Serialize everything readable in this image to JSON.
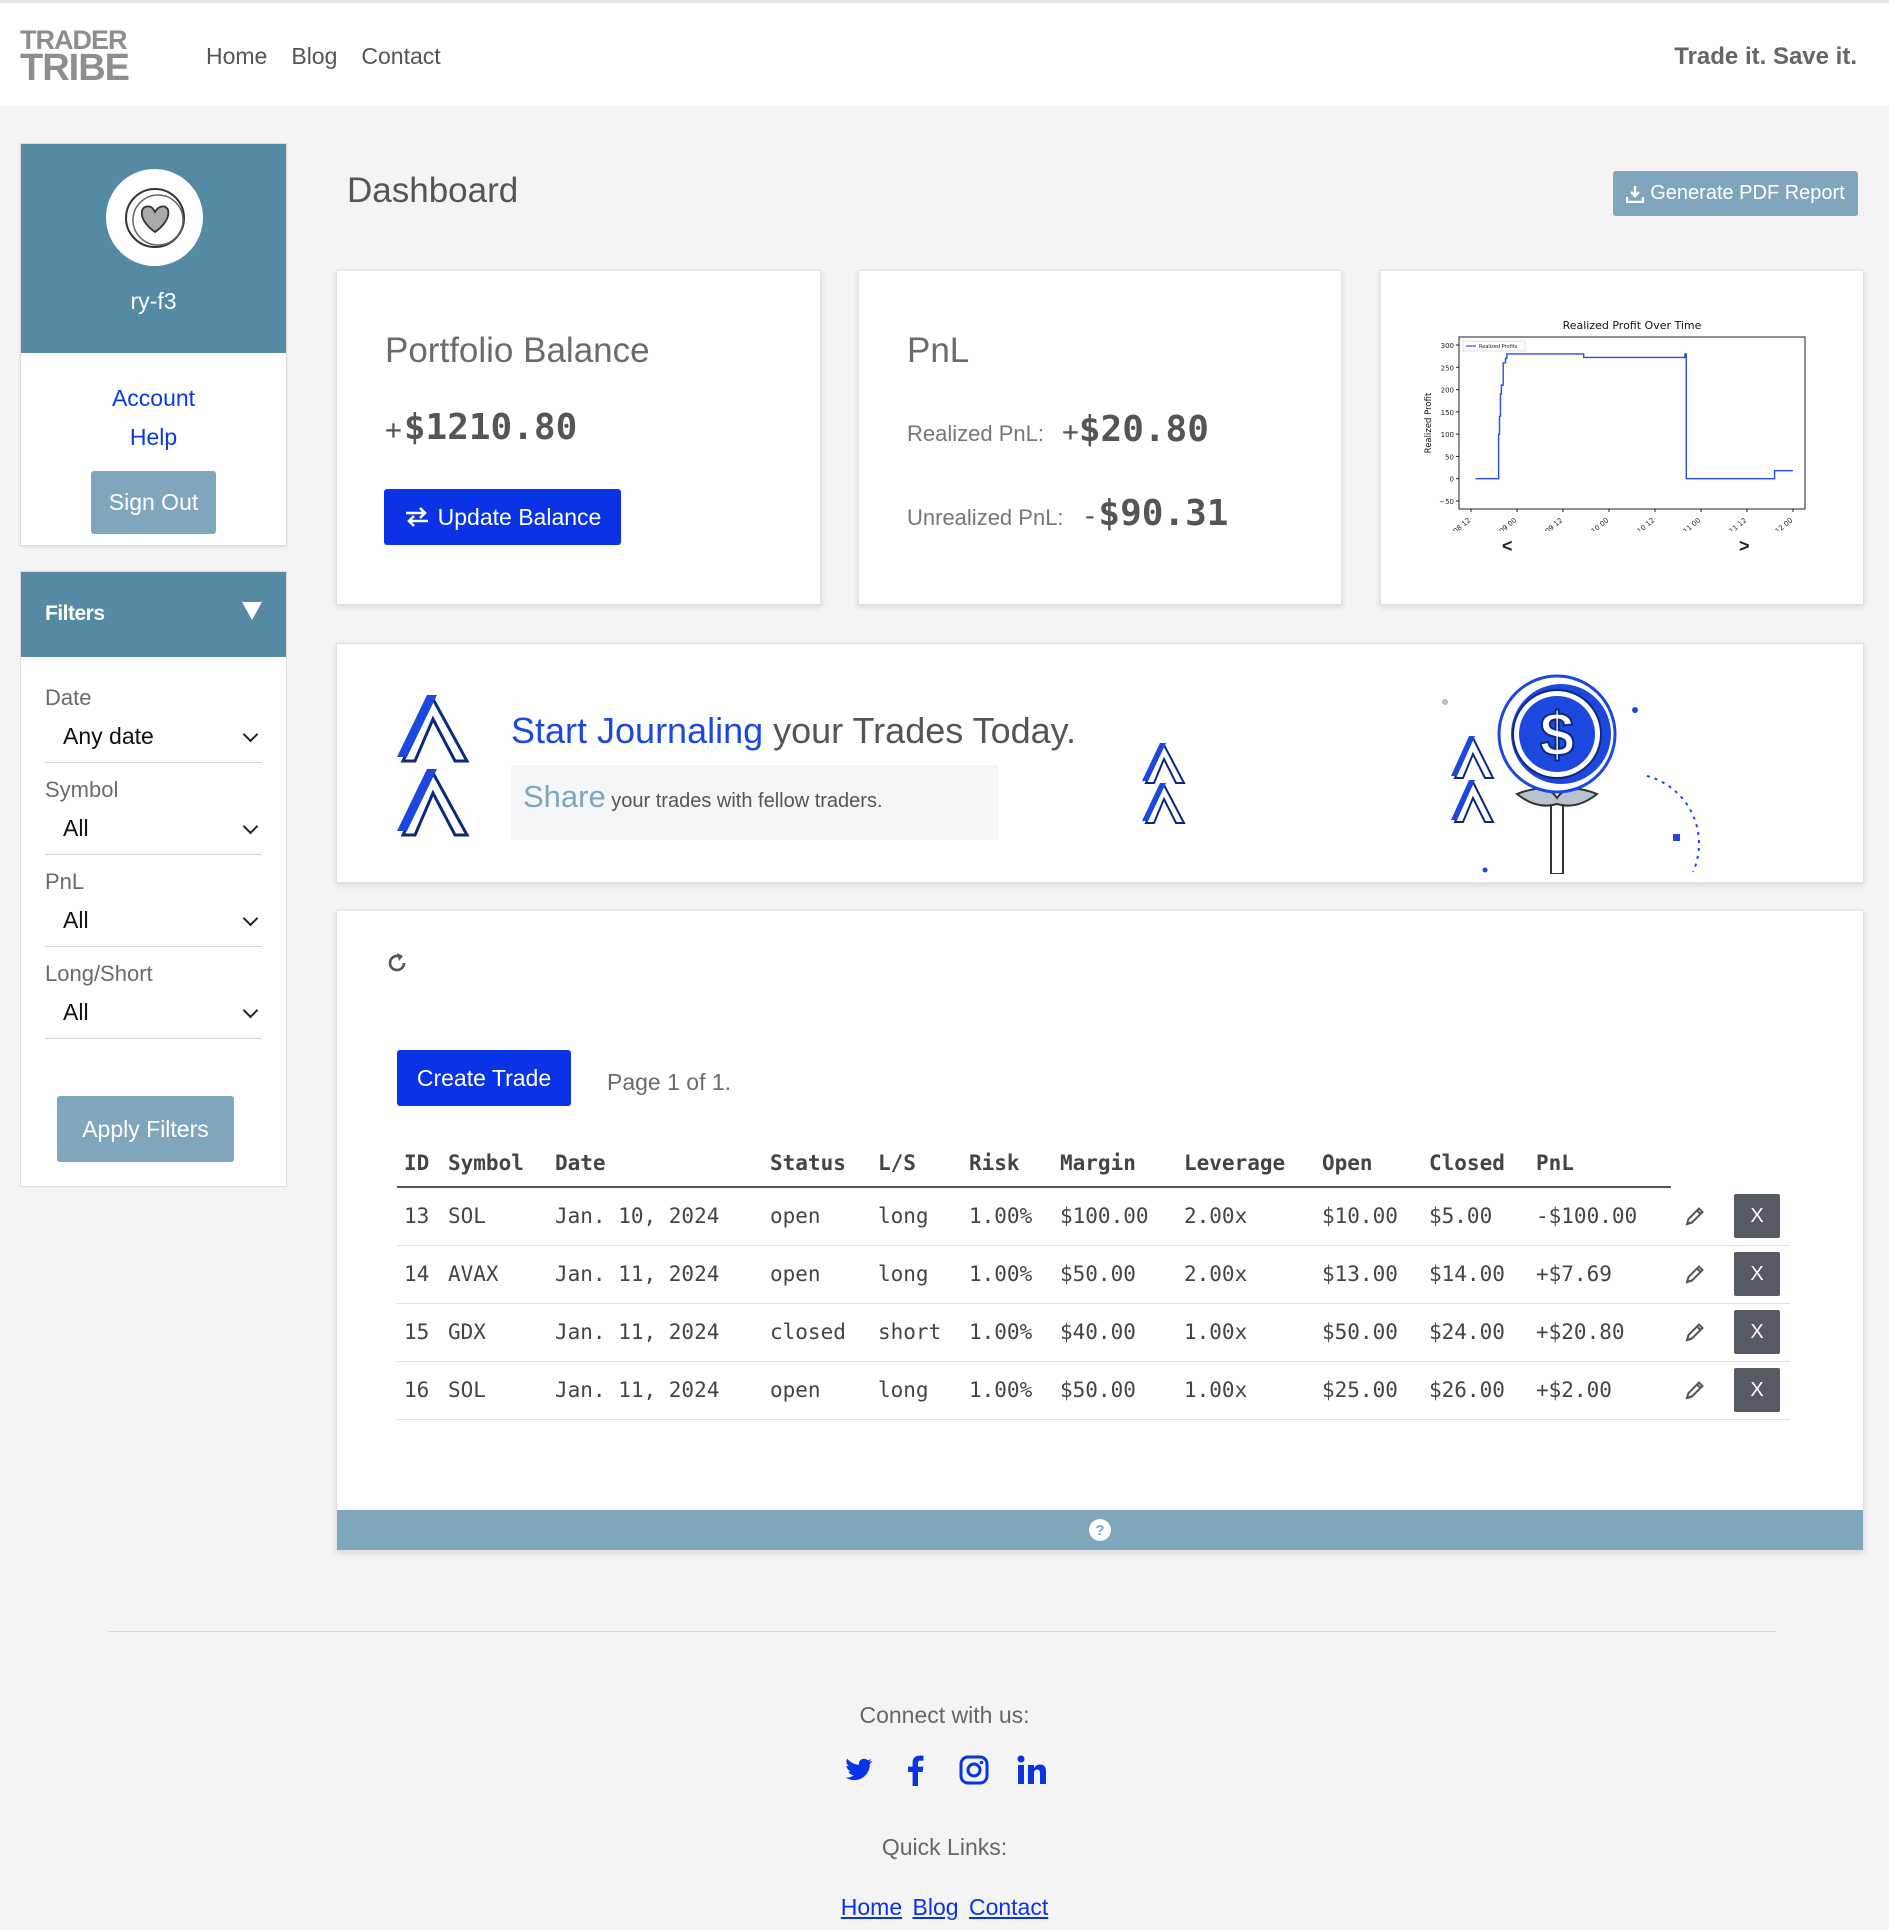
{
  "brand": {
    "line1": "TRADER",
    "line2": "TRIBE",
    "tagline": "Trade it. Save it."
  },
  "nav": {
    "links": [
      "Home",
      "Blog",
      "Contact"
    ]
  },
  "profile": {
    "username": "ry-f3",
    "links": [
      "Account",
      "Help"
    ],
    "signout_label": "Sign Out"
  },
  "filters": {
    "title": "Filters",
    "groups": [
      {
        "label": "Date",
        "value": "Any date"
      },
      {
        "label": "Symbol",
        "value": "All"
      },
      {
        "label": "PnL",
        "value": "All"
      },
      {
        "label": "Long/Short",
        "value": "All"
      }
    ],
    "apply_label": "Apply Filters"
  },
  "dashboard": {
    "title": "Dashboard",
    "pdf_label": "Generate PDF Report"
  },
  "portfolio": {
    "title": "Portfolio Balance",
    "sign": "+",
    "value": "$1210.80",
    "update_label": "Update Balance"
  },
  "pnl": {
    "title": "PnL",
    "realized_label": "Realized PnL:",
    "realized_sign": "+",
    "realized_value": "$20.80",
    "unrealized_label": "Unrealized PnL:",
    "unrealized_sign": "-",
    "unrealized_value": "$90.31"
  },
  "chart_nav": {
    "prev": "<",
    "next": ">"
  },
  "chart_data": {
    "type": "line",
    "title": "Realized Profit Over Time",
    "ylabel": "Realized Profit",
    "xlabel": "",
    "legend": [
      "Realized Profits"
    ],
    "legend_position": "top-left",
    "x_ticks": [
      "08 12",
      "09 00",
      "09 12",
      "10 00",
      "10 12",
      "11 00",
      "11 12",
      "12 00"
    ],
    "y_ticks": [
      "-50",
      "0",
      "50",
      "100",
      "150",
      "200",
      "250",
      "300"
    ],
    "ylim": [
      -50,
      300
    ],
    "grid": false,
    "series": [
      {
        "name": "Realized Profits",
        "x": [
          0.1,
          0.55,
          0.6,
          0.62,
          0.64,
          0.66,
          0.7,
          0.75,
          0.78,
          1.0,
          2.0,
          2.4,
          2.45,
          3.0,
          4.0,
          4.6,
          4.65,
          4.68,
          5.0,
          6.0,
          6.55,
          6.6,
          7.0
        ],
        "y": [
          0,
          0,
          100,
          140,
          190,
          210,
          260,
          270,
          280,
          280,
          280,
          280,
          272,
          272,
          272,
          272,
          280,
          0,
          0,
          0,
          0,
          18,
          18
        ]
      }
    ]
  },
  "banner": {
    "headline_highlight": "Start Journaling",
    "headline_rest": " your Trades Today.",
    "sub_highlight": "Share",
    "sub_rest": " your trades with fellow traders."
  },
  "trades": {
    "create_label": "Create Trade",
    "page_info": "Page 1 of 1.",
    "headers": [
      "ID",
      "Symbol",
      "Date",
      "Status",
      "L/S",
      "Risk",
      "Margin",
      "Leverage",
      "Open",
      "Closed",
      "PnL"
    ],
    "rows": [
      [
        "13",
        "SOL",
        "Jan. 10, 2024",
        "open",
        "long",
        "1.00%",
        "$100.00",
        "2.00x",
        "$10.00",
        "$5.00",
        "-$100.00"
      ],
      [
        "14",
        "AVAX",
        "Jan. 11, 2024",
        "open",
        "long",
        "1.00%",
        "$50.00",
        "2.00x",
        "$13.00",
        "$14.00",
        "+$7.69"
      ],
      [
        "15",
        "GDX",
        "Jan. 11, 2024",
        "closed",
        "short",
        "1.00%",
        "$40.00",
        "1.00x",
        "$50.00",
        "$24.00",
        "+$20.80"
      ],
      [
        "16",
        "SOL",
        "Jan. 11, 2024",
        "open",
        "long",
        "1.00%",
        "$50.00",
        "1.00x",
        "$25.00",
        "$26.00",
        "+$2.00"
      ]
    ],
    "delete_label": "X"
  },
  "footer": {
    "connect": "Connect with us:",
    "socials": [
      "twitter-icon",
      "facebook-icon",
      "instagram-icon",
      "linkedin-icon"
    ],
    "quick_links_title": "Quick Links:",
    "quick_links": [
      "Home",
      "Blog",
      "Contact"
    ]
  },
  "colors": {
    "primary": "#0a33e6",
    "steel": "#5589a4",
    "steel_light": "#7fa6bd",
    "link": "#0a3bd8"
  }
}
